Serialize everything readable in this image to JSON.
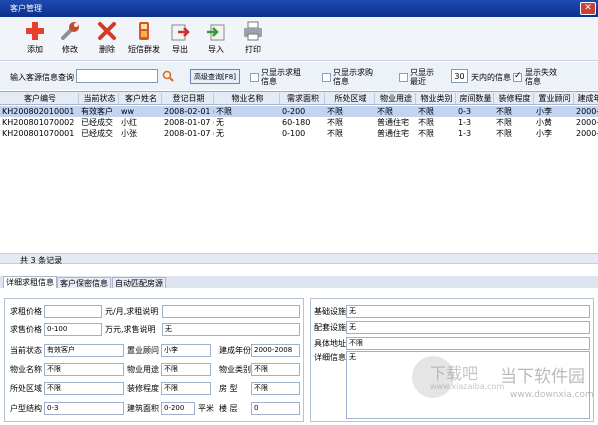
{
  "window": {
    "title": "客户管理",
    "close_label": "✕"
  },
  "toolbar": [
    {
      "icon": "plus-icon",
      "label": "添加"
    },
    {
      "icon": "wrench-icon",
      "label": "修改"
    },
    {
      "icon": "delete-x-icon",
      "label": "删除"
    },
    {
      "icon": "sms-phone-icon",
      "label": "短信群发"
    },
    {
      "icon": "export-icon",
      "label": "导出"
    },
    {
      "icon": "import-icon",
      "label": "导入"
    },
    {
      "icon": "printer-icon",
      "label": "打印"
    }
  ],
  "filter": {
    "search_label": "输入客源信息查询",
    "search_value": "",
    "advanced_label": "高级查询[F8]",
    "only_rent_label_1": "只显示求租",
    "only_rent_label_2": "信息",
    "only_buy_label_1": "只显示求购",
    "only_buy_label_2": "信息",
    "only_recent_label_1": "只显示",
    "only_recent_label_2": "最近",
    "days_value": "30",
    "days_label": "天内的信息",
    "show_invalid_label_1": "显示失效",
    "show_invalid_label_2": "信息",
    "only_rent_checked": false,
    "only_buy_checked": false,
    "only_recent_checked": false,
    "show_invalid_checked": true
  },
  "grid": {
    "columns": [
      "客户编号",
      "当前状态",
      "客户姓名",
      "登记日期",
      "物业名称",
      "需求面积",
      "所处区域",
      "物业用途",
      "物业类别",
      "房间数量",
      "装修程度",
      "置业顾问",
      "建成年"
    ],
    "rows": [
      [
        "KH200802010001",
        "有效客户",
        "ww",
        "2008-02-01 (",
        "不限",
        "0-200",
        "不限",
        "不限",
        "不限",
        "0-3",
        "不限",
        "小李",
        "2000-2"
      ],
      [
        "KH200801070002",
        "已经成交",
        "小红",
        "2008-01-07 (",
        "无",
        "60-180",
        "不限",
        "普通住宅",
        "不限",
        "1-3",
        "不限",
        "小黄",
        "2000-2"
      ],
      [
        "KH200801070001",
        "已经成交",
        "小张",
        "2008-01-07 (",
        "无",
        "0-100",
        "不限",
        "普通住宅",
        "不限",
        "1-3",
        "不限",
        "小李",
        "2000-2"
      ]
    ],
    "selected_row": 0
  },
  "status": {
    "record_count": "共 3 条记录"
  },
  "tabs": [
    "详细求租信息",
    "客户保密信息",
    "自动匹配房源"
  ],
  "details": {
    "rent_price_label": "求租价格",
    "rent_price_value": "",
    "rent_unit_label": "元/月,求租说明",
    "rent_note_value": "",
    "sale_price_label": "求售价格",
    "sale_price_value": "0-100",
    "sale_unit_label": "万元,求售说明",
    "sale_note_value": "无",
    "status_label": "当前状态",
    "status_value": "有效客户",
    "advisor_label": "置业顾问",
    "advisor_value": "小李",
    "built_year_label": "建成年份",
    "built_year_value": "2000-2008",
    "property_name_label": "物业名称",
    "property_name_value": "不限",
    "usage_label": "物业用途",
    "usage_value": "不限",
    "category_label": "物业类别",
    "category_value": "不限",
    "district_label": "所处区域",
    "district_value": "不限",
    "decoration_label": "装修程度",
    "decoration_value": "不限",
    "house_type_label": "房 型",
    "house_type_value": "不限",
    "layout_label": "户型结构",
    "layout_value": "0-3",
    "area_label": "建筑面积",
    "area_value": "0-200",
    "area_unit": "平米",
    "floor_label": "楼 层",
    "floor_value": "0",
    "facility_label": "基础设施",
    "facility_value": "无",
    "amenity_label": "配套设施",
    "amenity_value": "无",
    "address_label": "具体地址",
    "address_value": "不限",
    "detail_label": "详细信息",
    "detail_value": "无"
  },
  "watermarks": [
    "下载吧",
    "www.xiazaiba.com",
    "当下软件园",
    "www.downxia.com"
  ]
}
